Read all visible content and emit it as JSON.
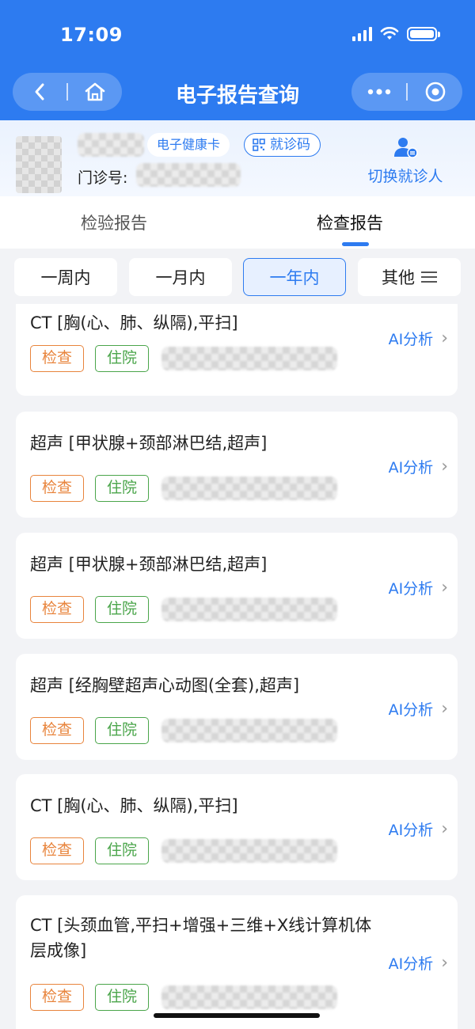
{
  "status_bar": {
    "time": "17:09"
  },
  "header": {
    "title": "电子报告查询"
  },
  "patient": {
    "health_card": "电子健康卡",
    "visit_code": "就诊码",
    "outpatient_label": "门诊号:",
    "switch_label": "切换就诊人"
  },
  "tabs": [
    {
      "label": "检验报告",
      "active": false
    },
    {
      "label": "检查报告",
      "active": true
    }
  ],
  "filters": [
    {
      "label": "一周内",
      "active": false
    },
    {
      "label": "一月内",
      "active": false
    },
    {
      "label": "一年内",
      "active": true
    },
    {
      "label": "其他",
      "active": false
    }
  ],
  "reports": [
    {
      "title": "CT [胸(心、肺、纵隔),平扫]",
      "tags": [
        "检查",
        "住院"
      ],
      "action": "AI分析"
    },
    {
      "title": "超声 [甲状腺+颈部淋巴结,超声]",
      "tags": [
        "检查",
        "住院"
      ],
      "action": "AI分析"
    },
    {
      "title": "超声 [甲状腺+颈部淋巴结,超声]",
      "tags": [
        "检查",
        "住院"
      ],
      "action": "AI分析"
    },
    {
      "title": "超声 [经胸壁超声心动图(全套),超声]",
      "tags": [
        "检查",
        "住院"
      ],
      "action": "AI分析"
    },
    {
      "title": "CT [胸(心、肺、纵隔),平扫]",
      "tags": [
        "检查",
        "住院"
      ],
      "action": "AI分析"
    },
    {
      "title": "CT [头颈血管,平扫+增强+三维+X线计算机体层成像]",
      "tags": [
        "检查",
        "住院"
      ],
      "action": "AI分析"
    }
  ],
  "colors": {
    "primary": "#2d7bf0",
    "tag_check": "#e8843c",
    "tag_inpatient": "#4aa54a"
  }
}
